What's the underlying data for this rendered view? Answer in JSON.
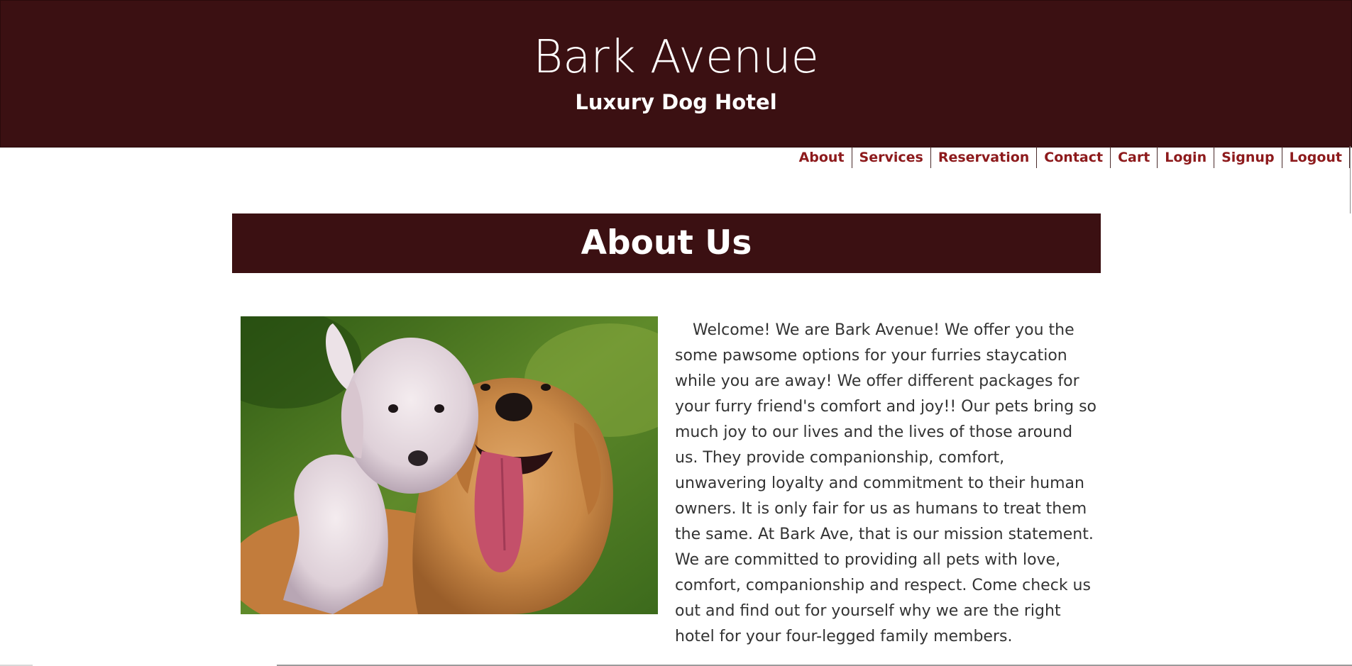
{
  "header": {
    "title": "Bark Avenue",
    "subtitle": "Luxury Dog Hotel"
  },
  "nav": {
    "items": [
      {
        "label": "About"
      },
      {
        "label": "Services"
      },
      {
        "label": "Reservation"
      },
      {
        "label": "Contact"
      },
      {
        "label": "Cart"
      },
      {
        "label": "Login"
      },
      {
        "label": "Signup"
      },
      {
        "label": "Logout"
      }
    ]
  },
  "main": {
    "heading": "About Us",
    "image": {
      "subject": "two dogs - a cream doodle puppy and a golden retriever with tongue out"
    },
    "paragraph": "Welcome! We are Bark Avenue! We offer you the some pawsome options for your furries staycation while you are away! We offer different packages for your furry friend's comfort and joy!! Our pets bring so much joy to our lives and the lives of those around us. They provide companionship, comfort, unwavering loyalty and commitment to their human owners. It is only fair for us as humans to treat them the same. At Bark Ave, that is our mission statement. We are committed to providing all pets with love, comfort, companionship and respect. Come check us out and find out for yourself why we are the right hotel for your four-legged family members."
  },
  "colors": {
    "brand_dark": "#3b1012",
    "nav_link": "#8d1a1c",
    "body_text": "#333333",
    "white": "#ffffff"
  }
}
